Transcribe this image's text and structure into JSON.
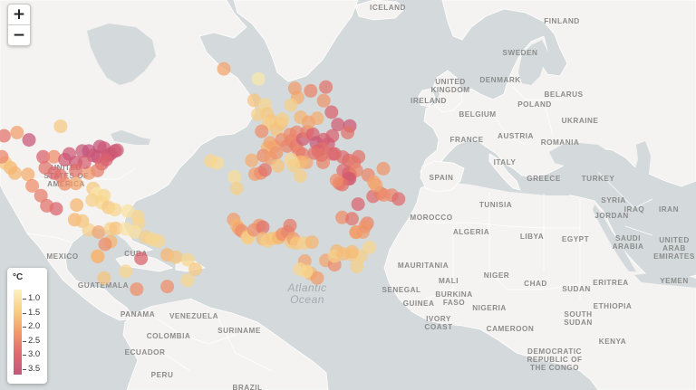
{
  "zoom": {
    "in_label": "+",
    "out_label": "−"
  },
  "legend": {
    "unit": "°C",
    "ticks": [
      "1.0",
      "1.5",
      "2.0",
      "2.5",
      "3.0",
      "3.5"
    ],
    "colors": [
      "#fbf2c0",
      "#f8cf84",
      "#f29a6a",
      "#e06a70",
      "#c2577a"
    ]
  },
  "ocean_label": [
    "Atlantic",
    "Ocean"
  ],
  "labels": {
    "iceland": "ICELAND",
    "finland": "FINLAND",
    "sweden": "SWEDEN",
    "denmark": "DENMARK",
    "united_kingdom": [
      "UNITED",
      "KINGDOM"
    ],
    "ireland": "IRELAND",
    "belgium": "BELGIUM",
    "belarus": "BELARUS",
    "poland": "POLAND",
    "ukraine": "UKRAINE",
    "france": "FRANCE",
    "austria": "AUSTRIA",
    "romania": "ROMANIA",
    "italy": "ITALY",
    "spain": "SPAIN",
    "greece": "GREECE",
    "turkey": "TURKEY",
    "syria": "SYRIA",
    "iraq": "IRAQ",
    "iran": "IRAN",
    "jordan": "JORDAN",
    "tunisia": "TUNISIA",
    "morocco": "MOROCCO",
    "algeria": "ALGERIA",
    "libya": "LIBYA",
    "egypt": "EGYPT",
    "saudi_arabia": [
      "SAUDI",
      "ARABIA"
    ],
    "uae": [
      "UNITED",
      "ARAB",
      "EMIRATES"
    ],
    "mauritania": "MAURITANIA",
    "mali": "MALI",
    "niger": "NIGER",
    "chad": "CHAD",
    "sudan": "SUDAN",
    "eritrea": "ERITREA",
    "yemen": "YEMEN",
    "senegal": "SENEGAL",
    "guinea": "GUINEA",
    "burkina_faso": [
      "BURKINA",
      "FASO"
    ],
    "ivory_coast": [
      "IVORY",
      "COAST"
    ],
    "nigeria": "NIGERIA",
    "cameroon": "CAMEROON",
    "ethiopia": "ETHIOPIA",
    "south_sudan": [
      "SOUTH",
      "SUDAN"
    ],
    "kenya": "KENYA",
    "drc": [
      "DEMOCRATIC",
      "REPUBLIC OF",
      "THE CONGO"
    ],
    "usa": [
      "UNITED",
      "STATES OF",
      "AMERICA"
    ],
    "mexico": "MEXICO",
    "cuba": "CUBA",
    "guatemala": "GUATEMALA",
    "panama": "PANAMA",
    "venezuela": "VENEZUELA",
    "colombia": "COLOMBIA",
    "suriname": "SURINAME",
    "ecuador": "ECUADOR",
    "peru": "PERU",
    "brazil": "BRAZIL"
  },
  "stations": {
    "comment_units": "degrees C warming; lon/lat in degrees",
    "points": [
      [
        -21.9,
        64.1,
        2.2
      ],
      [
        -97,
        49.9,
        1.7
      ],
      [
        -111.5,
        45.7,
        3.4
      ],
      [
        -105,
        40,
        3
      ],
      [
        -100,
        40,
        2.5
      ],
      [
        -95,
        39,
        3.2
      ],
      [
        -90,
        38,
        3.3
      ],
      [
        -87,
        42,
        3.4
      ],
      [
        -84,
        42,
        3.5
      ],
      [
        -82,
        40.5,
        3.3
      ],
      [
        -80,
        40,
        3.4
      ],
      [
        -79,
        43.5,
        3.5
      ],
      [
        -77,
        43,
        3.3
      ],
      [
        -75,
        40.5,
        3.3
      ],
      [
        -74,
        41,
        3.3
      ],
      [
        -72,
        42,
        3.4
      ],
      [
        -71,
        42.3,
        3.2
      ],
      [
        -76,
        39,
        3
      ],
      [
        -78,
        37.5,
        3
      ],
      [
        -80,
        35,
        2.7
      ],
      [
        -84,
        34,
        2.4
      ],
      [
        -86,
        38,
        3.1
      ],
      [
        -90,
        35,
        2.8
      ],
      [
        -93,
        41,
        3.3
      ],
      [
        -100,
        34,
        3
      ],
      [
        -97,
        33,
        2.8
      ],
      [
        -104,
        36,
        2.8
      ],
      [
        -112,
        33.5,
        2.1
      ],
      [
        -118,
        34,
        2
      ],
      [
        -120,
        36,
        2
      ],
      [
        -122.4,
        37.8,
        1.8
      ],
      [
        -124,
        40,
        2.6
      ],
      [
        -123,
        47,
        2.8
      ],
      [
        -117,
        48,
        2.3
      ],
      [
        -95,
        29.8,
        2.5
      ],
      [
        -90,
        30,
        2.2
      ],
      [
        -82,
        28,
        1.7
      ],
      [
        -80.2,
        25.8,
        1.2
      ],
      [
        -77,
        25,
        1.5
      ],
      [
        -82.4,
        23.1,
        1.6
      ],
      [
        -78,
        22,
        1.5
      ],
      [
        -75,
        20,
        1.7
      ],
      [
        -72,
        19,
        1.5
      ],
      [
        -66,
        18.4,
        1.3
      ],
      [
        -61.5,
        16,
        1.5
      ],
      [
        -61,
        13,
        1.5
      ],
      [
        -99,
        19.4,
        3
      ],
      [
        -103.3,
        20.7,
        2.8
      ],
      [
        -106,
        25,
        2.7
      ],
      [
        -110,
        29,
        2.5
      ],
      [
        -89.6,
        21,
        2
      ],
      [
        -90.5,
        14.6,
        2
      ],
      [
        -87,
        14,
        1.8
      ],
      [
        -84,
        10,
        1.6
      ],
      [
        -79.5,
        9,
        2.2
      ],
      [
        -74,
        10.5,
        1.6
      ],
      [
        -71.6,
        10.7,
        1.8
      ],
      [
        -66.9,
        10.5,
        1.3
      ],
      [
        -63,
        9,
        1.3
      ],
      [
        -58,
        6.8,
        1.6
      ],
      [
        -55,
        5.8,
        1.5
      ],
      [
        -52,
        4.9,
        1.5
      ],
      [
        -48,
        -1.4,
        2
      ],
      [
        -44,
        -2.5,
        1.8
      ],
      [
        -38.5,
        -3.7,
        1.5
      ],
      [
        -35,
        -8,
        1.7
      ],
      [
        -38.5,
        -13,
        1.5
      ],
      [
        -47.9,
        -15.8,
        2.5
      ],
      [
        -60,
        -3.1,
        3
      ],
      [
        -67,
        -9,
        1.5
      ],
      [
        -74,
        4.6,
        2
      ],
      [
        -76.5,
        3.4,
        2.5
      ],
      [
        -79.9,
        -2.2,
        2.2
      ],
      [
        -77,
        -12,
        1.8
      ],
      [
        -62,
        -17,
        2.5
      ],
      [
        -80,
        -2,
        1.9
      ],
      [
        -6,
        62,
        1.2
      ],
      [
        -8,
        57,
        1.8
      ],
      [
        -6.3,
        53.3,
        1.6
      ],
      [
        -3,
        55.9,
        1.5
      ],
      [
        -2,
        53.5,
        1.7
      ],
      [
        0,
        51.5,
        1.8
      ],
      [
        -1.5,
        50.7,
        1.6
      ],
      [
        2.3,
        48.9,
        1.8
      ],
      [
        4.4,
        50.8,
        1.8
      ],
      [
        5,
        52,
        1.6
      ],
      [
        -4.5,
        48.4,
        2.5
      ],
      [
        -1.7,
        43.3,
        2
      ],
      [
        -0.6,
        44.8,
        2.2
      ],
      [
        1.4,
        43.6,
        2.2
      ],
      [
        4.8,
        45.7,
        2.5
      ],
      [
        7.2,
        43.7,
        2.6
      ],
      [
        8.5,
        47.4,
        2.5
      ],
      [
        9.2,
        45.5,
        2.6
      ],
      [
        11.3,
        43.8,
        2.7
      ],
      [
        12.5,
        41.9,
        2.6
      ],
      [
        14.3,
        40.9,
        2.7
      ],
      [
        16,
        38,
        2.2
      ],
      [
        13.4,
        38.1,
        1.9
      ],
      [
        9,
        39,
        1.5
      ],
      [
        11.6,
        48.1,
        2.6
      ],
      [
        13.4,
        52.5,
        2
      ],
      [
        14.5,
        46,
        3.2
      ],
      [
        16.4,
        48.2,
        2.7
      ],
      [
        19,
        47.5,
        3
      ],
      [
        21,
        52.2,
        2.1
      ],
      [
        17,
        51.1,
        2.2
      ],
      [
        24,
        56.9,
        2.4
      ],
      [
        25,
        60.2,
        2.8
      ],
      [
        18,
        59.3,
        2.6
      ],
      [
        12,
        57.7,
        2.1
      ],
      [
        10.7,
        59.9,
        2.3
      ],
      [
        9,
        55.8,
        1.6
      ],
      [
        27.6,
        53.9,
        3
      ],
      [
        30.5,
        50.4,
        3.2
      ],
      [
        36,
        50,
        3.3
      ],
      [
        35,
        48,
        2.8
      ],
      [
        28,
        47,
        3
      ],
      [
        26.1,
        44.4,
        3.2
      ],
      [
        24,
        45.8,
        3.1
      ],
      [
        20.5,
        44.8,
        3.3
      ],
      [
        23.3,
        42.7,
        2.8
      ],
      [
        21.4,
        42,
        3
      ],
      [
        19.8,
        41.3,
        2.8
      ],
      [
        23.7,
        38,
        2.6
      ],
      [
        22.9,
        40.6,
        2.8
      ],
      [
        28,
        41,
        2.8
      ],
      [
        29,
        41,
        3
      ],
      [
        32.8,
        39.9,
        2.9
      ],
      [
        35.5,
        38.7,
        2.9
      ],
      [
        38,
        38,
        2.7
      ],
      [
        40,
        40,
        2.8
      ],
      [
        33,
        35,
        2.9
      ],
      [
        35.5,
        33.9,
        3
      ],
      [
        36.3,
        33.5,
        2.9
      ],
      [
        39,
        35,
        2.6
      ],
      [
        44.4,
        33.3,
        2.6
      ],
      [
        47,
        30.5,
        2.2
      ],
      [
        51.4,
        35.7,
        2.4
      ],
      [
        46.7,
        24.7,
        2.9
      ],
      [
        39.8,
        21.4,
        3
      ],
      [
        50,
        26,
        2.7
      ],
      [
        55.3,
        25.2,
        2.6
      ],
      [
        58.4,
        23.6,
        2.9
      ],
      [
        51.5,
        25.3,
        2.5
      ],
      [
        48,
        29.3,
        2.2
      ],
      [
        35.2,
        31.8,
        3
      ],
      [
        35.9,
        31.9,
        3.2
      ],
      [
        31.2,
        30,
        2.7
      ],
      [
        32.5,
        29.5,
        2.8
      ],
      [
        29.9,
        31.2,
        2.5
      ],
      [
        -7.6,
        33.6,
        2.3
      ],
      [
        -5,
        34,
        2.5
      ],
      [
        -3,
        35.2,
        2.8
      ],
      [
        -9.1,
        38.7,
        2.1
      ],
      [
        -3.7,
        40.4,
        2.5
      ],
      [
        -0.4,
        39.5,
        2.3
      ],
      [
        2.2,
        41.4,
        2.4
      ],
      [
        3,
        36.7,
        1.8
      ],
      [
        10.2,
        36.8,
        1.6
      ],
      [
        13.2,
        32.9,
        1.6
      ],
      [
        -17,
        32.6,
        1.4
      ],
      [
        -16,
        28,
        1.6
      ],
      [
        -25,
        37.8,
        1.4
      ],
      [
        -28,
        38.5,
        1.5
      ],
      [
        -17.4,
        14.7,
        2.3
      ],
      [
        -16,
        12,
        2
      ],
      [
        -15,
        10.5,
        2.2
      ],
      [
        -13.7,
        9.5,
        2.5
      ],
      [
        -11,
        7,
        1.8
      ],
      [
        -10.8,
        6.3,
        1.6
      ],
      [
        -8,
        10,
        2.5
      ],
      [
        -5.6,
        12,
        2.4
      ],
      [
        -4,
        11.2,
        2.8
      ],
      [
        -4,
        6,
        2
      ],
      [
        -2,
        5,
        1.6
      ],
      [
        0,
        6,
        1.8
      ],
      [
        2.5,
        6.4,
        1.7
      ],
      [
        3.4,
        6.5,
        2
      ],
      [
        5,
        8,
        2.5
      ],
      [
        7.5,
        9,
        2.6
      ],
      [
        8.5,
        12,
        2.7
      ],
      [
        9,
        4.6,
        1.7
      ],
      [
        10,
        6,
        2.3
      ],
      [
        11.5,
        3.9,
        1.7
      ],
      [
        15,
        4,
        1.6
      ],
      [
        18.6,
        4.4,
        2
      ],
      [
        15.3,
        -4.3,
        2.2
      ],
      [
        13,
        -8,
        1.5
      ],
      [
        18,
        -10,
        2
      ],
      [
        21,
        -12,
        2.3
      ],
      [
        25,
        -4,
        2.2
      ],
      [
        29,
        -6,
        2.5
      ],
      [
        32.5,
        15.6,
        2.5
      ],
      [
        37,
        15,
        2.8
      ],
      [
        39,
        9,
        2.5
      ],
      [
        38.8,
        8.9,
        2.2
      ],
      [
        42,
        9,
        2.3
      ],
      [
        44,
        13,
        2.6
      ],
      [
        43.1,
        11.6,
        2.4
      ],
      [
        45,
        2,
        1.5
      ],
      [
        41,
        -2,
        1.6
      ],
      [
        36.8,
        -1.3,
        1.7
      ],
      [
        37,
        0,
        1.9
      ],
      [
        39.2,
        -6.8,
        1.6
      ],
      [
        30,
        0.3,
        2
      ],
      [
        29,
        -2,
        1.6
      ],
      [
        33,
        -1,
        1.9
      ],
      [
        16,
        -9,
        1.5
      ]
    ]
  }
}
